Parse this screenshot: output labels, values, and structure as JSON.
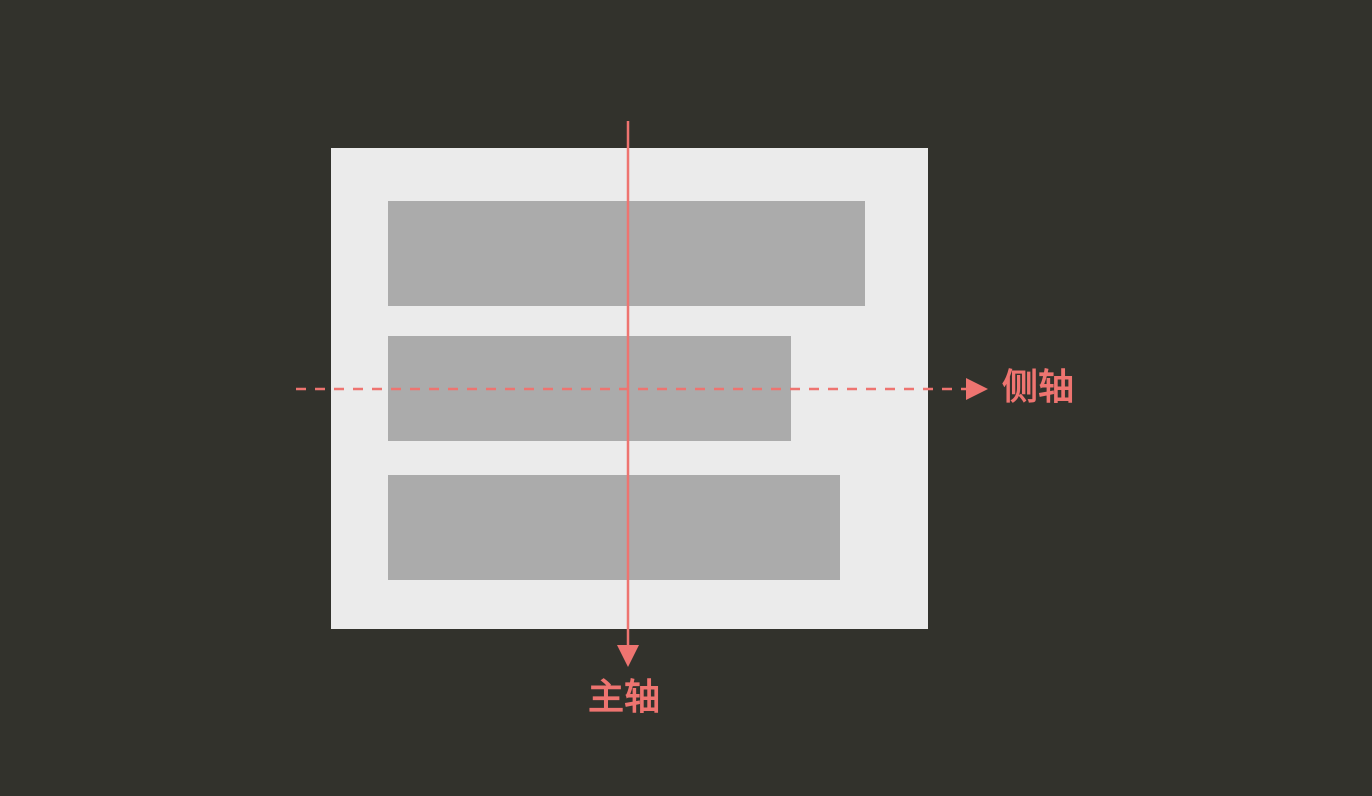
{
  "labels": {
    "cross_axis": "侧轴",
    "main_axis": "主轴"
  },
  "colors": {
    "background": "#32322c",
    "container": "#ebebeb",
    "item": "#ababab",
    "axis": "#ee7470"
  }
}
